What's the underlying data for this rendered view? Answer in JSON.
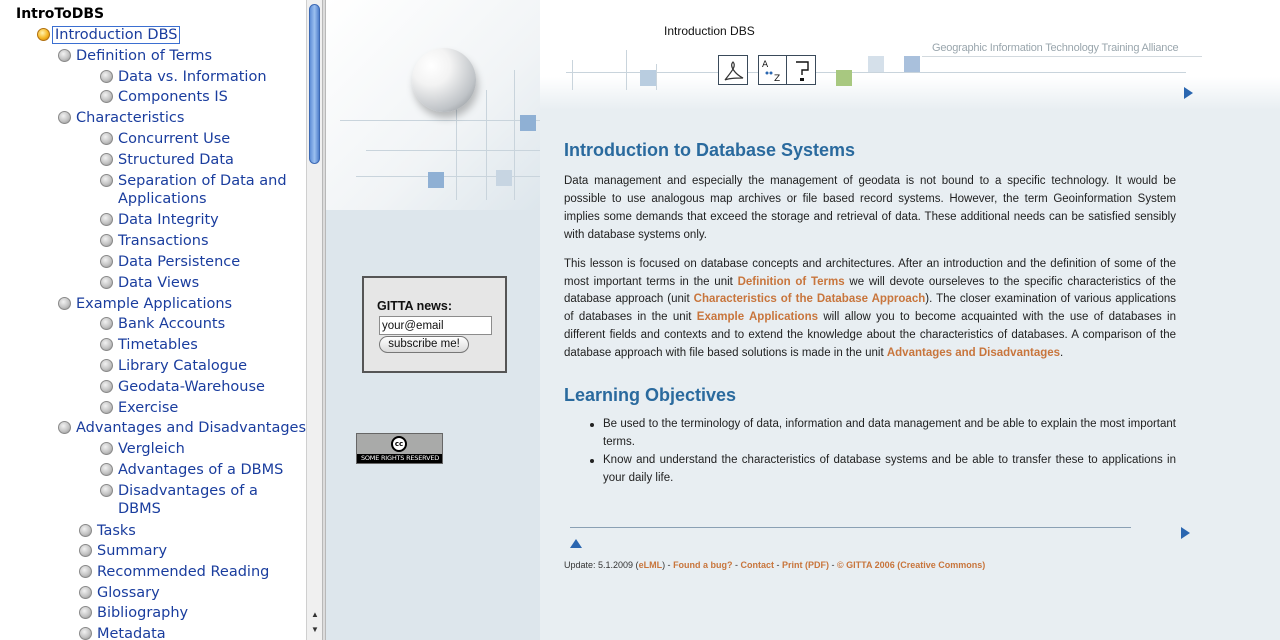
{
  "toc": {
    "title": "IntroToDBS",
    "items": [
      {
        "label": "Introduction DBS",
        "active": true,
        "level": 0
      },
      {
        "label": "Definition of Terms",
        "level": 1
      },
      {
        "label": "Data vs. Information",
        "level": 2
      },
      {
        "label": "Components IS",
        "level": 2
      },
      {
        "label": "Characteristics",
        "level": 1
      },
      {
        "label": "Concurrent Use",
        "level": 2
      },
      {
        "label": "Structured Data",
        "level": 2
      },
      {
        "label": "Separation of Data and",
        "label2": "Applications",
        "level": 2
      },
      {
        "label": "Data Integrity",
        "level": 2
      },
      {
        "label": "Transactions",
        "level": 2
      },
      {
        "label": "Data Persistence",
        "level": 2
      },
      {
        "label": "Data Views",
        "level": 2
      },
      {
        "label": "Example Applications",
        "level": 1
      },
      {
        "label": "Bank Accounts",
        "level": 2
      },
      {
        "label": "Timetables",
        "level": 2
      },
      {
        "label": "Library Catalogue",
        "level": 2
      },
      {
        "label": "Geodata-Warehouse",
        "level": 2
      },
      {
        "label": "Exercise",
        "level": 2
      },
      {
        "label": "Advantages and Disadvantages",
        "level": 1
      },
      {
        "label": "Vergleich",
        "level": 2
      },
      {
        "label": "Advantages of a DBMS",
        "level": 2
      },
      {
        "label": "Disadvantages of a",
        "label2": "DBMS",
        "level": 2
      },
      {
        "label": "Tasks",
        "level": 1.5
      },
      {
        "label": "Summary",
        "level": 1.5
      },
      {
        "label": "Recommended Reading",
        "level": 1.5
      },
      {
        "label": "Glossary",
        "level": 1.5
      },
      {
        "label": "Bibliography",
        "level": 1.5
      },
      {
        "label": "Metadata",
        "level": 1.5
      }
    ]
  },
  "banner": {
    "title": "Introduction DBS",
    "org": "Geographic Information Technology Training Alliance",
    "glossary_icon": "A..Z-glossary-icon",
    "help_icon": "help-icon"
  },
  "news": {
    "label": "GITTA news:",
    "input_value": "your@email",
    "button": "subscribe me!"
  },
  "cc": {
    "logo": "cc",
    "text": "SOME RIGHTS RESERVED"
  },
  "main": {
    "title": "Introduction to Database Systems",
    "p1": "Data management and especially the management of geodata is not bound to a specific technology. It would be possible to use analogous map archives or file based record systems. However, the term Geoinformation System implies some demands that exceed the storage and retrieval of data. These additional needs can be satisfied sensibly with database systems only.",
    "p2": {
      "t1": "This lesson is focused on database concepts and architectures. After an introduction and the definition of some of the most important terms in the unit ",
      "l1": "Definition of Terms",
      "t2": " we will devote ourseleves to the specific characteristics of the database approach (unit ",
      "l2": "Characteristics of the Database Approach",
      "t3": "). The closer examination of various applications of databases in the unit ",
      "l3": "Example Applications",
      "t4": " will allow you to become acquainted with the use of databases in different fields and contexts and to extend the knowledge about the characteristics of databases. A comparison of the database approach with file based solutions is made in the unit ",
      "l4": "Advantages and Disadvantages",
      "t5": "."
    },
    "objectives_title": "Learning Objectives",
    "objectives": [
      "Be used to the terminology of data, information and data management and be able to explain the most important terms.",
      "Know and understand the characteristics of database systems and be able to transfer these to applications in your daily life."
    ]
  },
  "footer": {
    "prefix": "Update: 5.1.2009 (",
    "eml": "eLML",
    "sep1": ") - ",
    "bug": "Found a bug?",
    "sep2": " - ",
    "contact": "Contact",
    "sep3": " - ",
    "print": "Print (PDF)",
    "sep4": " - ",
    "copyright": "© GITTA 2006 (Creative Commons)"
  },
  "colors": {
    "link": "#1a3d9e",
    "heading": "#2a6a9e",
    "inline_link": "#c8753c"
  }
}
